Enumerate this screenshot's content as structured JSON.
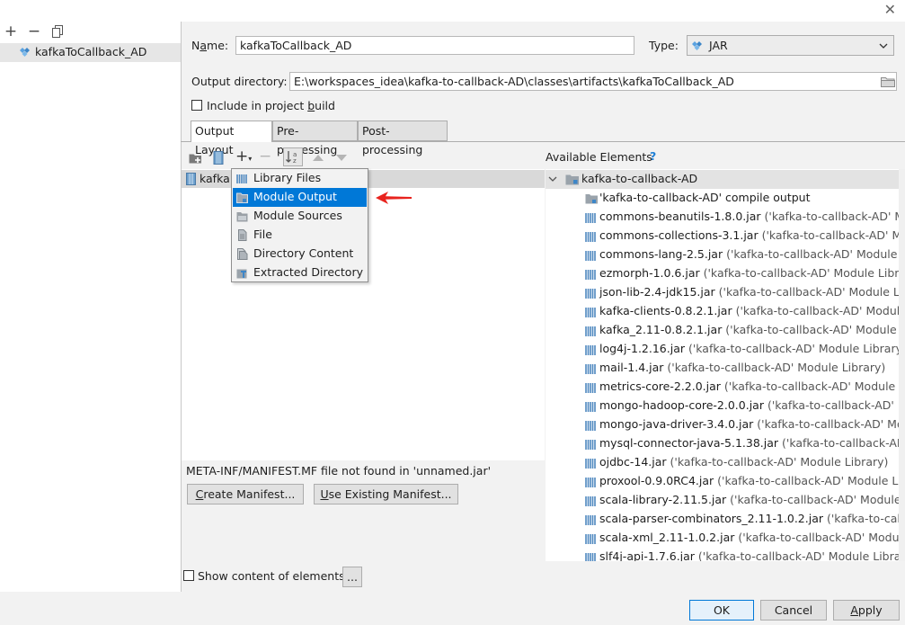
{
  "window": {
    "close_glyph": "✕"
  },
  "left_toolbar": {
    "add": "+",
    "remove": "−",
    "copy_icon": "copy-icon"
  },
  "artifacts": [
    {
      "label": "kafkaToCallback_AD"
    }
  ],
  "form": {
    "name_label": "Name:",
    "name_value": "kafkaToCallback_AD",
    "type_label": "Type:",
    "type_value": "JAR",
    "output_dir_label": "Output directory:",
    "output_dir_value": "E:\\workspaces_idea\\kafka-to-callback-AD\\classes\\artifacts\\kafkaToCallback_AD",
    "include_label": "Include in project build"
  },
  "tabs": [
    {
      "label": "Output Layout",
      "active": true
    },
    {
      "label": "Pre-processing",
      "active": false
    },
    {
      "label": "Post-processing",
      "active": false
    }
  ],
  "layout_tree": {
    "root_label": "kafka"
  },
  "popup_menu": [
    {
      "label": "Library Files",
      "icon": "library-icon"
    },
    {
      "label": "Module Output",
      "icon": "module-output-icon",
      "selected": true
    },
    {
      "label": "Module Sources",
      "icon": "module-sources-icon"
    },
    {
      "label": "File",
      "icon": "file-icon"
    },
    {
      "label": "Directory Content",
      "icon": "directory-content-icon"
    },
    {
      "label": "Extracted Directory",
      "icon": "extracted-directory-icon"
    }
  ],
  "manifest": {
    "message": "META-INF/MANIFEST.MF file not found in 'unnamed.jar'",
    "create_button": "Create Manifest...",
    "use_existing_button": "Use Existing Manifest..."
  },
  "show_content_label": "Show content of elements",
  "ellipsis_button": "...",
  "available": {
    "title": "Available Elements",
    "help": "?",
    "module": "kafka-to-callback-AD",
    "compile_output": "'kafka-to-callback-AD' compile output",
    "libraries": [
      {
        "jar": "commons-beanutils-1.8.0.jar",
        "suffix": " ('kafka-to-callback-AD' Module Library)"
      },
      {
        "jar": "commons-collections-3.1.jar",
        "suffix": " ('kafka-to-callback-AD' Module Library)"
      },
      {
        "jar": "commons-lang-2.5.jar",
        "suffix": " ('kafka-to-callback-AD' Module Library)"
      },
      {
        "jar": "ezmorph-1.0.6.jar",
        "suffix": " ('kafka-to-callback-AD' Module Library)"
      },
      {
        "jar": "json-lib-2.4-jdk15.jar",
        "suffix": " ('kafka-to-callback-AD' Module Library)"
      },
      {
        "jar": "kafka-clients-0.8.2.1.jar",
        "suffix": " ('kafka-to-callback-AD' Module Library)"
      },
      {
        "jar": "kafka_2.11-0.8.2.1.jar",
        "suffix": " ('kafka-to-callback-AD' Module Library)"
      },
      {
        "jar": "log4j-1.2.16.jar",
        "suffix": " ('kafka-to-callback-AD' Module Library)"
      },
      {
        "jar": "mail-1.4.jar",
        "suffix": " ('kafka-to-callback-AD' Module Library)"
      },
      {
        "jar": "metrics-core-2.2.0.jar",
        "suffix": " ('kafka-to-callback-AD' Module Library)"
      },
      {
        "jar": "mongo-hadoop-core-2.0.0.jar",
        "suffix": " ('kafka-to-callback-AD' Module Library)"
      },
      {
        "jar": "mongo-java-driver-3.4.0.jar",
        "suffix": " ('kafka-to-callback-AD' Module Library)"
      },
      {
        "jar": "mysql-connector-java-5.1.38.jar",
        "suffix": " ('kafka-to-callback-AD' Module Library)"
      },
      {
        "jar": "ojdbc-14.jar",
        "suffix": " ('kafka-to-callback-AD' Module Library)"
      },
      {
        "jar": "proxool-0.9.0RC4.jar",
        "suffix": " ('kafka-to-callback-AD' Module Library)"
      },
      {
        "jar": "scala-library-2.11.5.jar",
        "suffix": " ('kafka-to-callback-AD' Module Library)"
      },
      {
        "jar": "scala-parser-combinators_2.11-1.0.2.jar",
        "suffix": " ('kafka-to-callback-AD' Module Library)"
      },
      {
        "jar": "scala-xml_2.11-1.0.2.jar",
        "suffix": " ('kafka-to-callback-AD' Module Library)"
      },
      {
        "jar": "slf4j-api-1.7.6.jar",
        "suffix": " ('kafka-to-callback-AD' Module Library)"
      }
    ]
  },
  "dialog_buttons": {
    "ok": "OK",
    "cancel": "Cancel",
    "apply": "Apply"
  },
  "colors": {
    "selection": "#0078d7",
    "arrow": "#e8231e",
    "accent_help": "#1f7fd5"
  }
}
